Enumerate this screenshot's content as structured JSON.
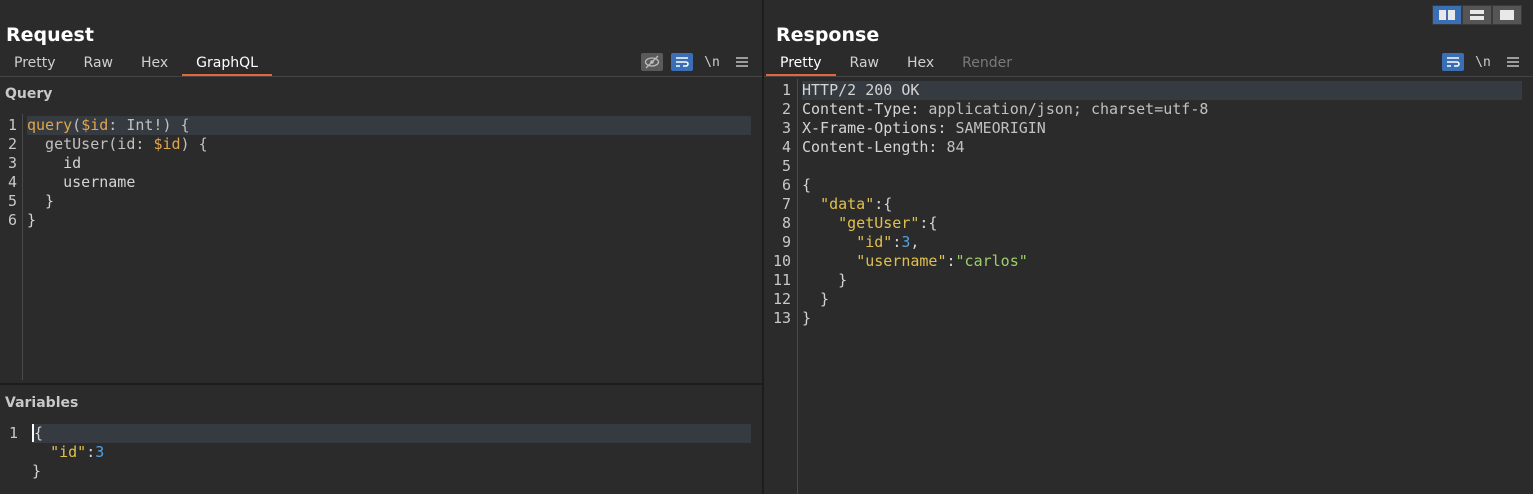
{
  "request": {
    "title": "Request",
    "tabs": [
      {
        "label": "Pretty"
      },
      {
        "label": "Raw"
      },
      {
        "label": "Hex"
      },
      {
        "label": "GraphQL",
        "active": true
      }
    ],
    "icons": [
      "hide-icon",
      "word-wrap-icon",
      "newline-icon",
      "menu-icon"
    ],
    "newline_label": "\\n",
    "query_label": "Query",
    "query_line_numbers": [
      "1",
      "2",
      "3",
      "4",
      "5",
      "6"
    ],
    "variables_label": "Variables",
    "variables_line_numbers": [
      "1"
    ]
  },
  "response": {
    "title": "Response",
    "tabs": [
      {
        "label": "Pretty",
        "active": true
      },
      {
        "label": "Raw"
      },
      {
        "label": "Hex"
      },
      {
        "label": "Render",
        "disabled": true
      }
    ],
    "icons": [
      "word-wrap-icon",
      "newline-icon",
      "menu-icon"
    ],
    "newline_label": "\\n",
    "line_numbers": [
      "1",
      "2",
      "3",
      "4",
      "5",
      "6",
      "7",
      "8",
      "9",
      "10",
      "11",
      "12",
      "13"
    ],
    "headers": {
      "status_line": "HTTP/2 200 OK",
      "content_type_name": "Content-Type:",
      "content_type_value": " application/json; charset=utf-8",
      "x_frame_name": "X-Frame-Options:",
      "x_frame_value": " SAMEORIGIN",
      "content_length_name": "Content-Length:",
      "content_length_value": " 84"
    },
    "body": {
      "data_key": "\"data\"",
      "getuser_key": "\"getUser\"",
      "id_key": "\"id\"",
      "id_value": "3",
      "username_key": "\"username\"",
      "username_value": "\"carlos\""
    }
  },
  "query": {
    "kw_query": "query",
    "var_id": "$id",
    "type": ": Int!) {",
    "field_getuser": "  getUser(id: ",
    "var_id_2": "$id",
    "field_getuser_end": ") {",
    "field_id": "    id",
    "field_username": "    username",
    "close_inner": "  }",
    "close_outer": "}"
  },
  "variables": {
    "open": "{",
    "id_key": "\"id\"",
    "id_value": "3",
    "close": "}"
  },
  "layout_toggle": [
    "split-horizontal-icon",
    "split-vertical-icon",
    "single-pane-icon"
  ],
  "colors": {
    "accent": "#e0683c",
    "button_blue": "#3b6fb5",
    "background": "#2b2b2b"
  }
}
